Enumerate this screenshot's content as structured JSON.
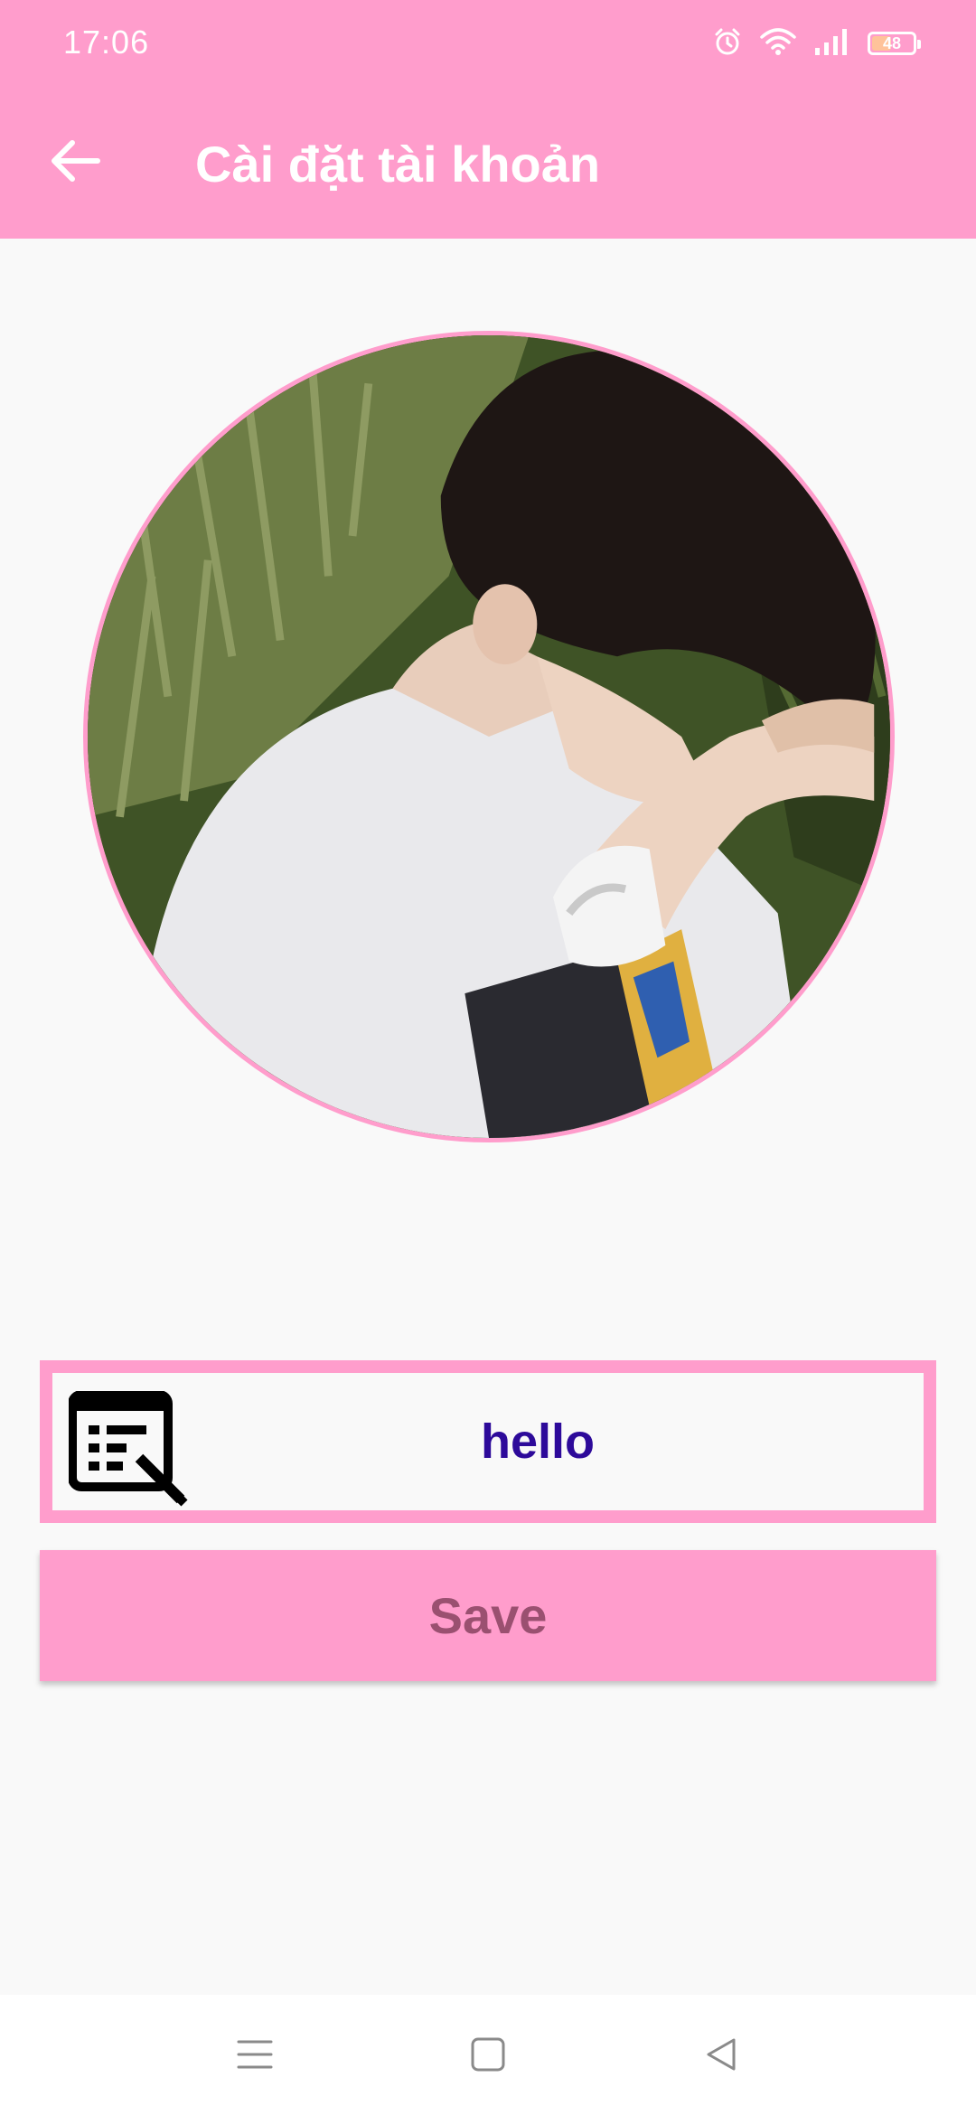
{
  "status_bar": {
    "time": "17:06",
    "icons": [
      "alarm-icon",
      "wifi-icon",
      "cellular-signal-icon"
    ],
    "battery": {
      "level": 48,
      "text": "48"
    }
  },
  "app_bar": {
    "back_icon": "arrow-left-icon",
    "title": "Cài đặt tài khoản"
  },
  "profile": {
    "avatar_description": "profile-photo"
  },
  "name_field": {
    "icon": "form-edit-icon",
    "value": "hello"
  },
  "save_button": {
    "label": "Save"
  },
  "nav_bar": {
    "items": [
      "menu-icon",
      "home-icon",
      "back-triangle-icon"
    ]
  },
  "colors": {
    "accent": "#ff9dcc",
    "background": "#f9f9f9",
    "name_text": "#2d0a9a",
    "save_text": "#9a5070"
  }
}
